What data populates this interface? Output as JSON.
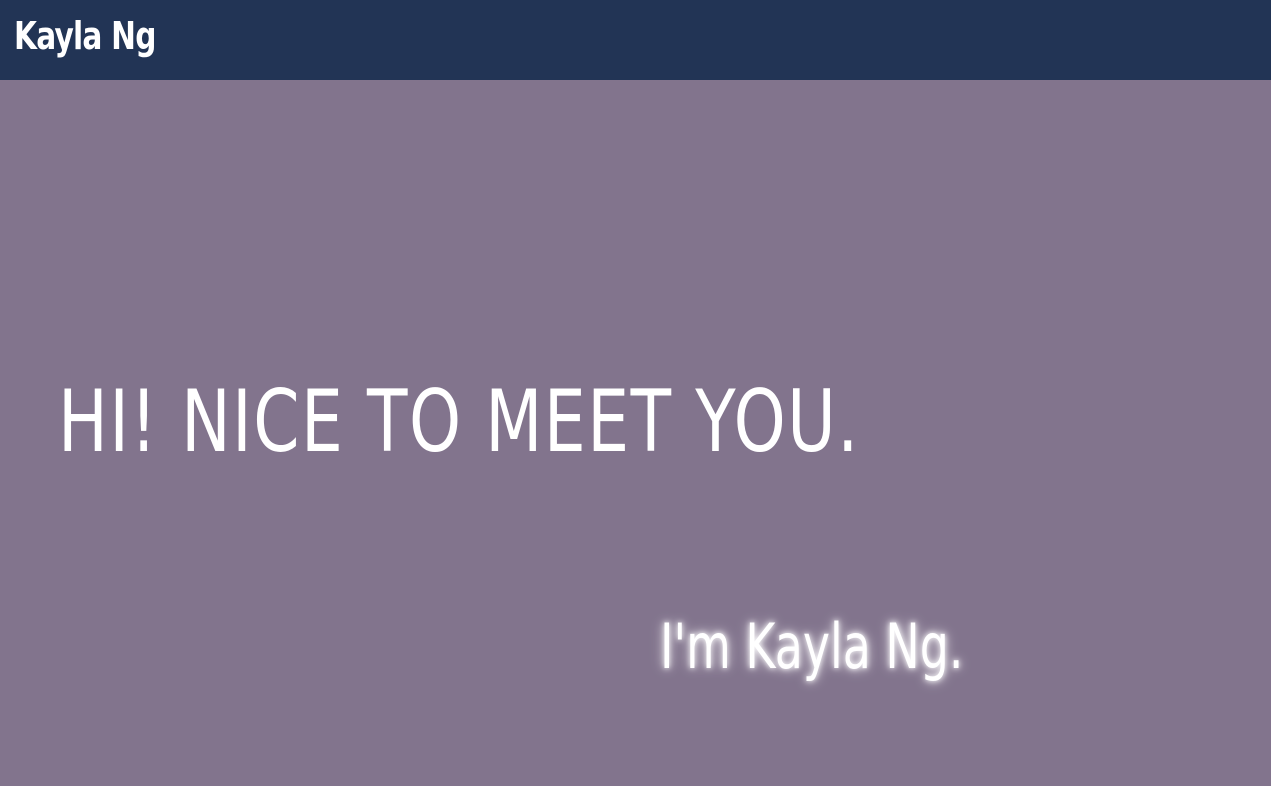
{
  "colors": {
    "navbar_background": "#223455",
    "page_background": "#82748d",
    "text": "#ffffff"
  },
  "navbar": {
    "brand": "Kayla Ng"
  },
  "hero": {
    "headline": "HI! NICE TO MEET YOU.",
    "intro": "I'm Kayla Ng."
  }
}
